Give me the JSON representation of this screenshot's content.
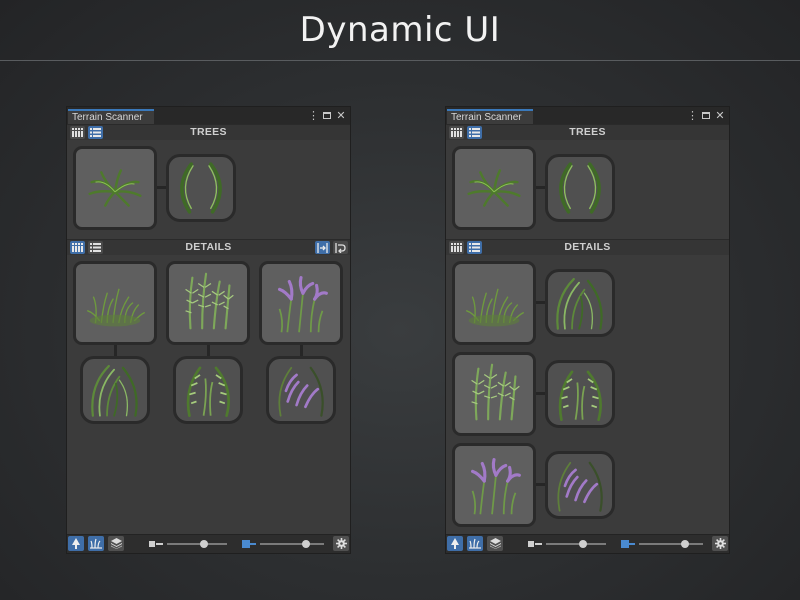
{
  "page": {
    "title": "Dynamic UI"
  },
  "windows": [
    {
      "id": "left",
      "tab_title": "Terrain Scanner",
      "sections": {
        "trees": {
          "title": "TREES"
        },
        "details": {
          "title": "DETAILS"
        }
      },
      "sliders": [
        {
          "value": 0.62
        },
        {
          "value": 0.72
        }
      ]
    },
    {
      "id": "right",
      "tab_title": "Terrain Scanner",
      "sections": {
        "trees": {
          "title": "TREES"
        },
        "details": {
          "title": "DETAILS"
        }
      },
      "sliders": [
        {
          "value": 0.62
        },
        {
          "value": 0.72
        }
      ]
    }
  ],
  "icons": {
    "window_menu": "kebab-menu-icon",
    "window_maximize": "maximize-icon",
    "window_close": "close-icon",
    "grid_view": "grid-view-icon",
    "list_view": "list-view-icon",
    "align": "align-icon",
    "wrap": "wrap-icon",
    "tree": "tree-icon",
    "grass": "grass-icon",
    "layers": "layers-icon",
    "settings": "gear-icon"
  },
  "colors": {
    "accent": "#3f6ea8",
    "tab_highlight": "#3a79bb",
    "panel": "#3b3b3b",
    "slot": "#5f5f5f"
  }
}
